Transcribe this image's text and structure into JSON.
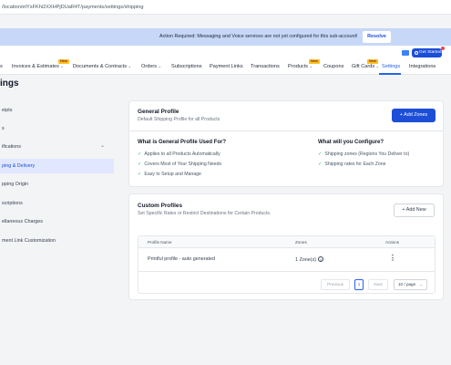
{
  "browser": {
    "url": "/location/etYsFKhi2XXHPjDUaR4T/payments/settings/shipping"
  },
  "banner": {
    "message": "Action Required: Messaging and Voice services are not yet configured for this sub-account!",
    "resolve_label": "Resolve"
  },
  "header": {
    "get_started_label": "Get Started"
  },
  "nav": {
    "items": [
      {
        "label": "s",
        "chevron": ""
      },
      {
        "label": "Invoices & Estimates",
        "chevron": "⌄"
      },
      {
        "label": "Documents & Contracts",
        "chevron": "⌄"
      },
      {
        "label": "Orders",
        "chevron": "⌄"
      },
      {
        "label": "Subscriptions",
        "chevron": ""
      },
      {
        "label": "Payment Links",
        "chevron": ""
      },
      {
        "label": "Transactions",
        "chevron": ""
      },
      {
        "label": "Products",
        "chevron": "⌄"
      },
      {
        "label": "Coupons",
        "chevron": ""
      },
      {
        "label": "Gift Cards",
        "chevron": "⌄"
      },
      {
        "label": "Settings",
        "chevron": ""
      },
      {
        "label": "Integrations",
        "chevron": ""
      }
    ],
    "badge_label": "New",
    "active": "Settings"
  },
  "page": {
    "title": "ings"
  },
  "sidebar": {
    "items": [
      {
        "label": "eipts"
      },
      {
        "label": "s"
      },
      {
        "label": "ifications"
      },
      {
        "label": "ping & Delivery"
      },
      {
        "label": "pping Origin"
      },
      {
        "label": "scriptions"
      },
      {
        "label": "ellaneous Charges"
      },
      {
        "label": "ment Link Customization"
      }
    ],
    "active_index": 3
  },
  "general_profile": {
    "title": "General Profile",
    "subtitle": "Default Shipping Profile for all Products",
    "add_zones_label": "+ Add Zones",
    "used_for": {
      "heading": "What is General Profile Used For?",
      "items": [
        "Applies to all Products Automatically",
        "Covers Most of Your Shipping Needs",
        "Easy to Setup and Manage"
      ]
    },
    "configure": {
      "heading": "What will you Configure?",
      "items": [
        "Shipping zones (Regions You Deliver to)",
        "Shipping rates for Each Zone"
      ]
    }
  },
  "custom_profiles": {
    "title": "Custom Profiles",
    "subtitle": "Set Specific Rates or Restrict Destinations for Certain Products.",
    "add_new_label": "+ Add New",
    "table": {
      "columns": [
        "Profile Name",
        "Zones",
        "Actions"
      ],
      "rows": [
        {
          "name": "Printful profile - auto generated",
          "zones": "1 Zone(s)"
        }
      ]
    },
    "pagination": {
      "previous": "Previous",
      "page": "1",
      "next": "Next",
      "page_size": "10 / page"
    }
  },
  "colors": {
    "accent": "#2563eb",
    "primary_button": "#1d4ed8",
    "banner_bg": "#c7d7f7",
    "check": "#10b981",
    "new_badge": "#fbbf24"
  },
  "icons": {
    "check": "check-icon",
    "info": "info-icon",
    "kebab": "more-vertical-icon"
  }
}
